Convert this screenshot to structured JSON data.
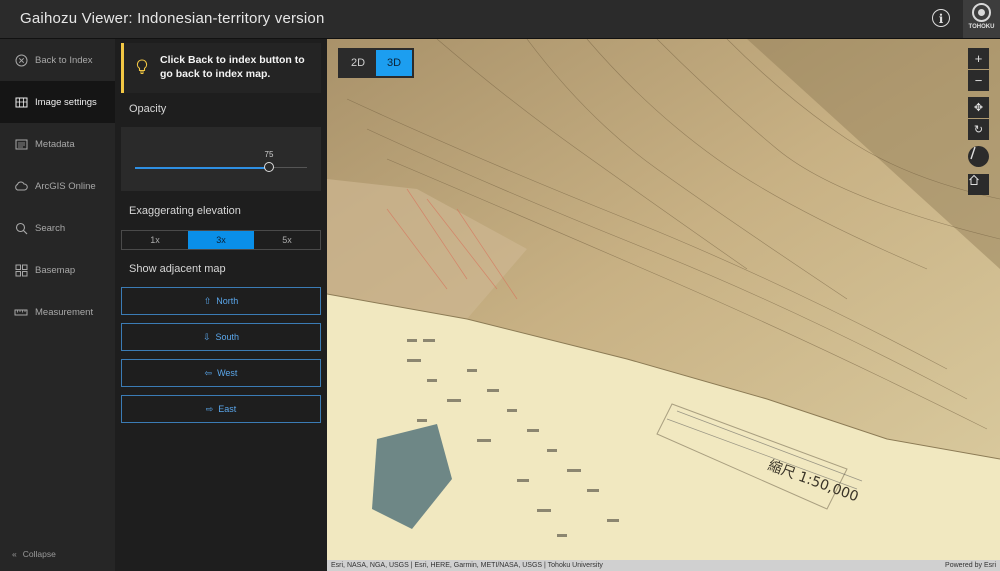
{
  "app": {
    "title": "Gaihozu Viewer: Indonesian-territory version",
    "logo_text": "TOHOKU"
  },
  "nav": {
    "items": [
      {
        "label": "Back to Index",
        "icon": "close-circle-icon"
      },
      {
        "label": "Image settings",
        "icon": "map-layers-icon",
        "active": true
      },
      {
        "label": "Metadata",
        "icon": "document-list-icon"
      },
      {
        "label": "ArcGIS Online",
        "icon": "cloud-icon"
      },
      {
        "label": "Search",
        "icon": "search-icon"
      },
      {
        "label": "Basemap",
        "icon": "grid-icon"
      },
      {
        "label": "Measurement",
        "icon": "ruler-icon"
      }
    ],
    "collapse_label": "Collapse"
  },
  "panel": {
    "tip": "Click Back to index button to go back to index map.",
    "opacity_label": "Opacity",
    "opacity_value": "75",
    "opacity_fraction": 0.75,
    "exaggeration_label": "Exaggerating elevation",
    "exaggeration_options": [
      "1x",
      "3x",
      "5x"
    ],
    "exaggeration_selected": "3x",
    "adjacent_label": "Show adjacent map",
    "adjacent_buttons": [
      {
        "label": "North",
        "arrow": "⇧"
      },
      {
        "label": "South",
        "arrow": "⇩"
      },
      {
        "label": "West",
        "arrow": "⇦"
      },
      {
        "label": "East",
        "arrow": "⇨"
      }
    ]
  },
  "map": {
    "view_2d": "2D",
    "view_3d": "3D",
    "active_view": "3D",
    "scale_text": "縮尺 1:50,000",
    "attribution": "Esri, NASA, NGA, USGS | Esri, HERE, Garmin, METI/NASA, USGS | Tohoku University",
    "powered_by": "Powered by Esri",
    "accent_color": "#1c9ef0"
  }
}
